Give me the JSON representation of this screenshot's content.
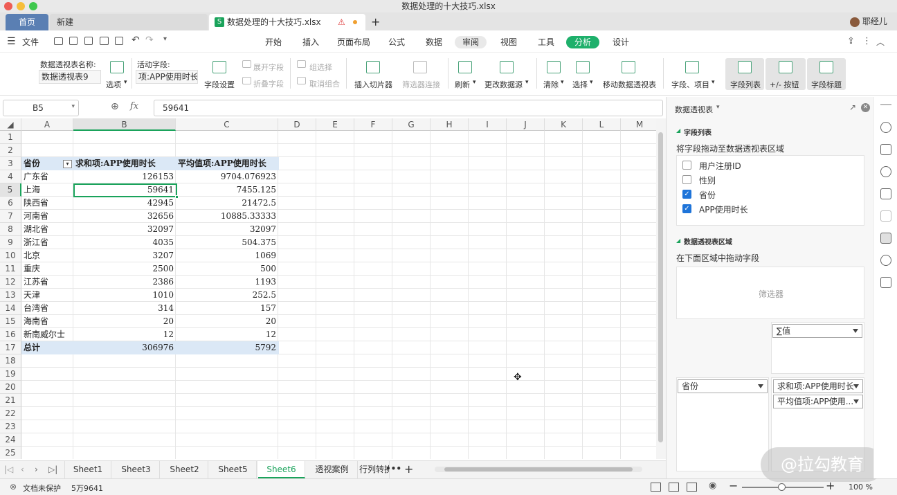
{
  "window": {
    "title": "数据处理的十大技巧.xlsx"
  },
  "tabs": {
    "home": "首页",
    "new": "新建",
    "file": "数据处理的十大技巧.xlsx",
    "add": "+",
    "user": "耶经儿"
  },
  "menu": {
    "file": "文件",
    "items": [
      "开始",
      "插入",
      "页面布局",
      "公式",
      "数据",
      "审阅",
      "视图",
      "工具",
      "分析",
      "设计"
    ]
  },
  "ribbon": {
    "pivot_name_label": "数据透视表名称:",
    "pivot_name_value": "数据透视表9",
    "options": "选项",
    "active_field_label": "活动字段:",
    "active_field_value": "项:APP使用时长",
    "field_settings": "字段设置",
    "expand_field": "展开字段",
    "collapse_field": "折叠字段",
    "group_select": "组选择",
    "ungroup": "取消组合",
    "insert_slicer": "插入切片器",
    "filter_connect": "筛选器连接",
    "refresh": "刷新",
    "change_source": "更改数据源",
    "clear": "清除",
    "select": "选择",
    "move_pivot": "移动数据透视表",
    "fields_items": "字段、项目",
    "field_list": "字段列表",
    "plus_minus": "+/- 按钮",
    "field_headers": "字段标题"
  },
  "formula": {
    "name_box": "B5",
    "fx": "fx",
    "value": "59641"
  },
  "columns": [
    "A",
    "B",
    "C",
    "D",
    "E",
    "F",
    "G",
    "H",
    "I",
    "J",
    "K",
    "L",
    "M"
  ],
  "rows": [
    "1",
    "2",
    "3",
    "4",
    "5",
    "6",
    "7",
    "8",
    "9",
    "10",
    "11",
    "12",
    "13",
    "14",
    "15",
    "16",
    "17",
    "18",
    "19",
    "20",
    "21",
    "22",
    "23",
    "24",
    "25"
  ],
  "table": {
    "header": [
      "省份",
      "求和项:APP使用时长",
      "平均值项:APP使用时长"
    ],
    "data": [
      [
        "广东省",
        "126153",
        "9704.076923"
      ],
      [
        "上海",
        "59641",
        "7455.125"
      ],
      [
        "陕西省",
        "42945",
        "21472.5"
      ],
      [
        "河南省",
        "32656",
        "10885.33333"
      ],
      [
        "湖北省",
        "32097",
        "32097"
      ],
      [
        "浙江省",
        "4035",
        "504.375"
      ],
      [
        "北京",
        "3207",
        "1069"
      ],
      [
        "重庆",
        "2500",
        "500"
      ],
      [
        "江苏省",
        "2386",
        "1193"
      ],
      [
        "天津",
        "1010",
        "252.5"
      ],
      [
        "台湾省",
        "314",
        "157"
      ],
      [
        "海南省",
        "20",
        "20"
      ],
      [
        "新南威尔士",
        "12",
        "12"
      ]
    ],
    "total": [
      "总计",
      "306976",
      "5792"
    ]
  },
  "sheets": [
    "Sheet1",
    "Sheet3",
    "Sheet2",
    "Sheet5",
    "Sheet6",
    "透视案例",
    "行列转换"
  ],
  "sheets_more": "•••",
  "sheets_add": "+",
  "status": {
    "protect": "文档未保护",
    "count": "5万9641",
    "zoom": "100 %"
  },
  "panel": {
    "title": "数据透视表",
    "field_list_header": "字段列表",
    "drag_hint": "将字段拖动至数据透视表区域",
    "fields": [
      {
        "name": "用户注册ID",
        "checked": false
      },
      {
        "name": "性别",
        "checked": false
      },
      {
        "name": "省份",
        "checked": true
      },
      {
        "name": "APP使用时长",
        "checked": true
      }
    ],
    "area_header": "数据透视表区域",
    "area_hint": "在下面区域中拖动字段",
    "filter_label": "筛选器",
    "values_dropdown": "∑值",
    "row_field": "省份",
    "value_field_1": "求和项:APP使用时长",
    "value_field_2": "平均值项:APP使用..."
  },
  "watermark": "@拉勾教育"
}
